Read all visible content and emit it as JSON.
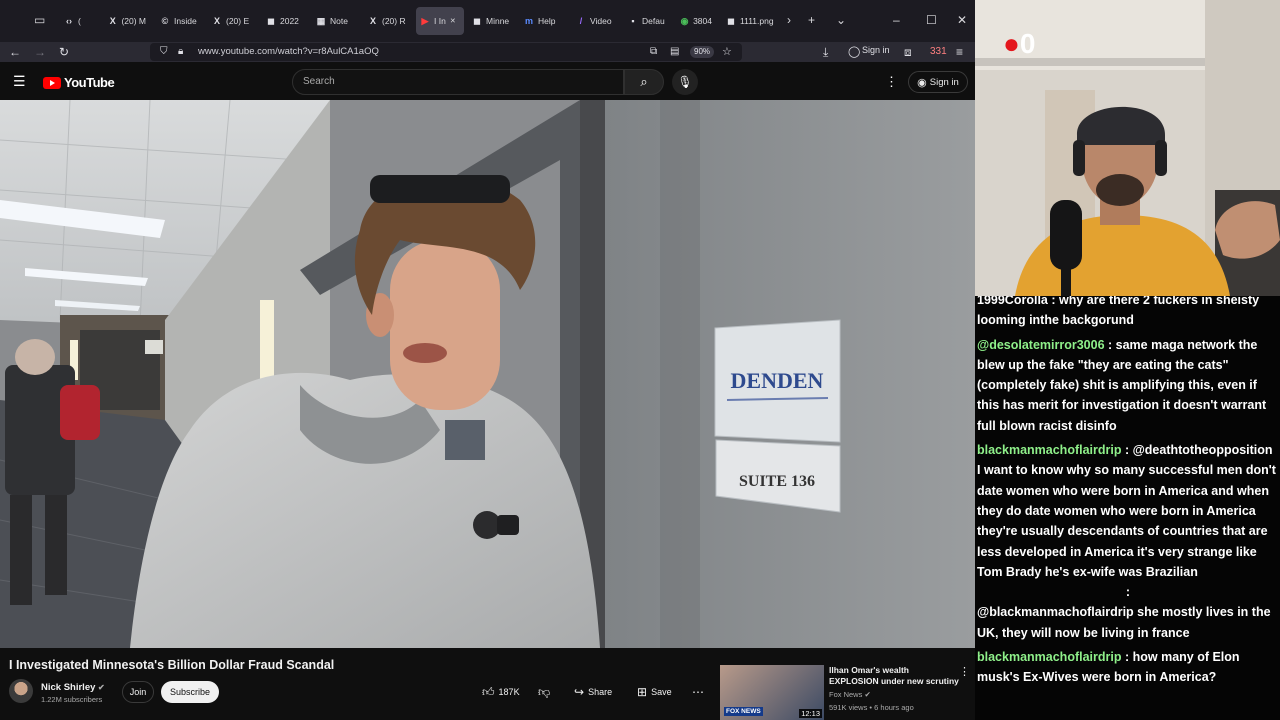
{
  "browser": {
    "tabs": [
      {
        "label": "(",
        "favicon": "tab-nav-icon",
        "active": false
      },
      {
        "label": "(20) M",
        "favicon": "x-icon",
        "active": false
      },
      {
        "label": "Inside",
        "favicon": "c-icon",
        "active": false
      },
      {
        "label": "(20) E",
        "favicon": "x-icon",
        "active": false
      },
      {
        "label": "2022",
        "favicon": "dark-icon",
        "active": false
      },
      {
        "label": "Note",
        "favicon": "note-icon",
        "active": false
      },
      {
        "label": "(20) R",
        "favicon": "x-icon",
        "active": false
      },
      {
        "label": "I In",
        "favicon": "youtube-icon",
        "active": true
      },
      {
        "label": "Minne",
        "favicon": "dark-icon",
        "active": false
      },
      {
        "label": "Help",
        "favicon": "m-icon",
        "active": false
      },
      {
        "label": "Video",
        "favicon": "slash-icon",
        "active": false
      },
      {
        "label": "Defau",
        "favicon": "cal-icon",
        "active": false
      },
      {
        "label": "3804",
        "favicon": "pin-icon",
        "active": false
      },
      {
        "label": "1111.png",
        "favicon": "dark-icon",
        "active": false
      }
    ],
    "url": "www.youtube.com/watch?v=r8AulCA1aOQ",
    "zoom": "90%",
    "signin_label": "Sign in",
    "extension_badge": "331"
  },
  "youtube": {
    "logo_text": "YouTube",
    "search_placeholder": "Search",
    "signin_label": "Sign in",
    "video_title": "I Investigated Minnesota's Billion Dollar Fraud Scandal",
    "channel_name": "Nick Shirley",
    "subscribers": "1.22M subscribers",
    "join_label": "Join",
    "subscribe_label": "Subscribe",
    "likes": "187K",
    "share_label": "Share",
    "save_label": "Save",
    "video_sign_text": "DENDEN",
    "video_suite_text": "SUITE 136",
    "recommendation": {
      "title": "Ilhan Omar's wealth EXPLOSION under new scrutiny",
      "channel": "Fox News",
      "meta": "591K views • 6 hours ago",
      "duration": "12:13",
      "thumb_tag": "FOX NEWS"
    }
  },
  "stream": {
    "counter": "0",
    "chat": [
      {
        "user": "",
        "text": "1999Corolla : why are there 2 fuckers in sheisty looming inthe backgorund"
      },
      {
        "user": "@desolatemirror3006",
        "text": " : same maga network the blew up the fake \"they are eating the cats\" (completely fake) shit is amplifying this, even if this has merit for investigation it doesn't warrant full blown racist disinfo"
      },
      {
        "user": "blackmanmachoflairdrip",
        "text": " : @deathtotheopposition I want to know why so many successful men don't date women who were born in America and when they do date women who were born in America they're usually descendants of countries that are less developed in America it's very strange like Tom Brady he's ex-wife was Brazilian"
      },
      {
        "user": "",
        "text": ":"
      },
      {
        "user": "",
        "text": "@blackmanmachoflairdrip she mostly lives in the UK, they will now be living in france"
      },
      {
        "user": "blackmanmachoflairdrip",
        "text": " : how many of Elon musk's Ex-Wives were born in America?"
      }
    ]
  },
  "colors": {
    "chat_username": "#8ff08a",
    "youtube_red": "#ff0000",
    "browser_bg": "#1c1b22"
  }
}
